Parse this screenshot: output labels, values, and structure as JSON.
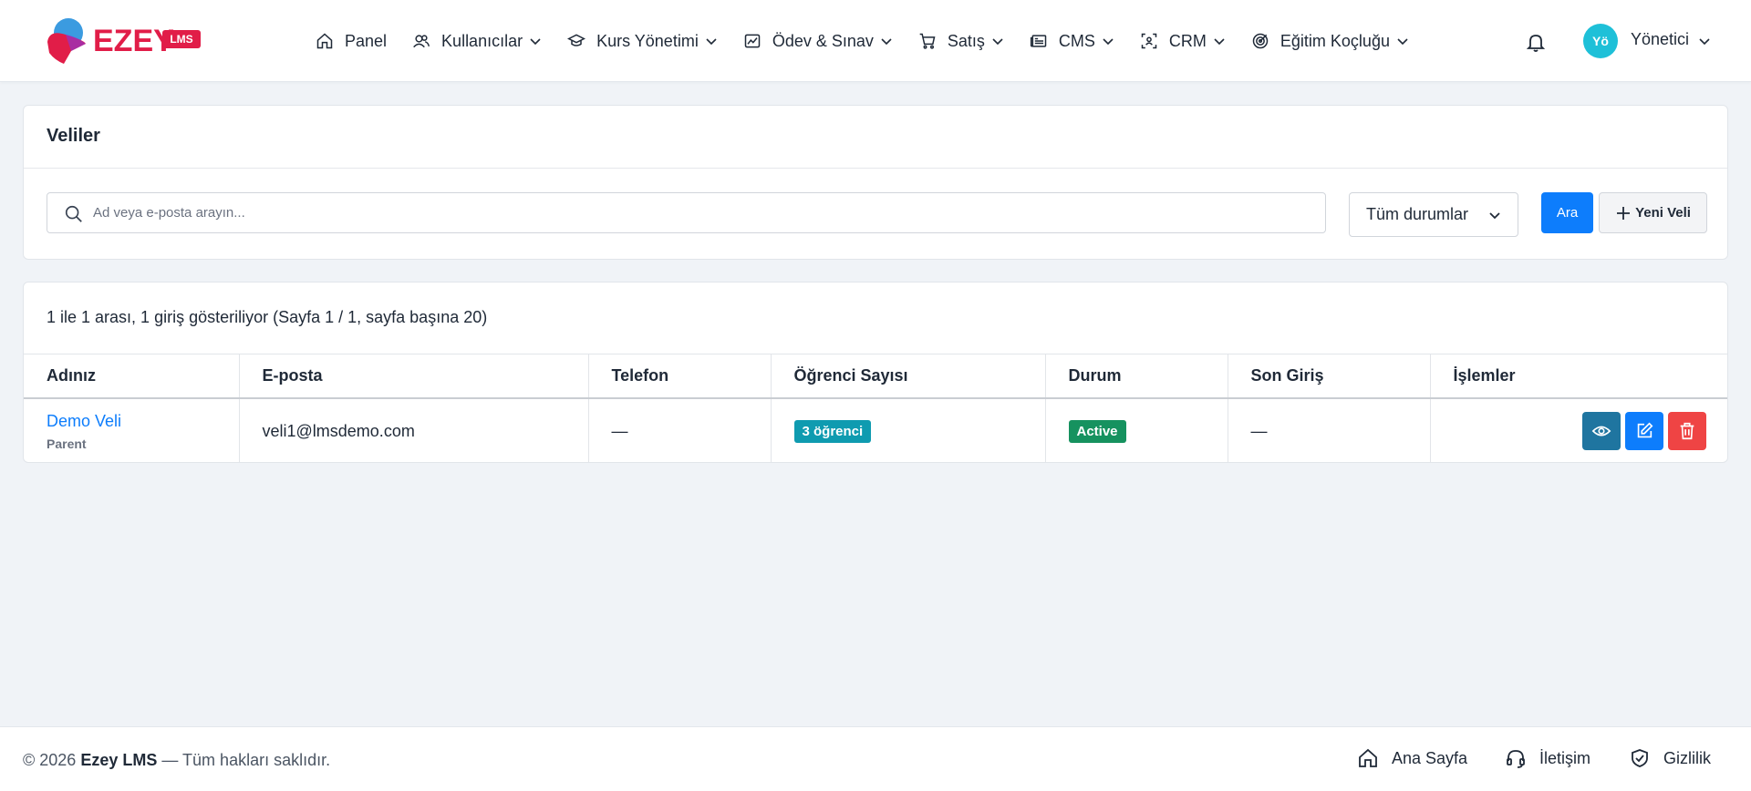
{
  "brand": {
    "name": "EZEY",
    "badge": "LMS"
  },
  "nav": {
    "items": [
      {
        "label": "Panel",
        "icon": "home-icon"
      },
      {
        "label": "Kullanıcılar",
        "icon": "users-icon"
      },
      {
        "label": "Kurs Yönetimi",
        "icon": "graduation-cap-icon"
      },
      {
        "label": "Ödev & Sınav",
        "icon": "chart-image-icon"
      },
      {
        "label": "Satış",
        "icon": "cart-icon"
      },
      {
        "label": "CMS",
        "icon": "newspaper-icon"
      },
      {
        "label": "CRM",
        "icon": "scan-person-icon"
      },
      {
        "label": "Eğitim Koçluğu",
        "icon": "target-icon"
      }
    ]
  },
  "user": {
    "initials": "Yö",
    "label": "Yönetici"
  },
  "search_card": {
    "title": "Veliler",
    "search_placeholder": "Ad veya e-posta arayın...",
    "status_selected": "Tüm durumlar",
    "search_button": "Ara",
    "new_button": "Yeni Veli"
  },
  "table_card": {
    "info": "1 ile 1 arası, 1 giriş gösteriliyor (Sayfa 1 / 1, sayfa başına 20)",
    "headers": [
      "Adınız",
      "E-posta",
      "Telefon",
      "Öğrenci Sayısı",
      "Durum",
      "Son Giriş",
      "İşlemler"
    ],
    "rows": [
      {
        "name": "Demo Veli",
        "role": "Parent",
        "email": "veli1@lmsdemo.com",
        "phone": "—",
        "students": "3 öğrenci",
        "status": "Active",
        "last_login": "—"
      }
    ]
  },
  "footer": {
    "copy_prefix": "© 2026",
    "copy_brand": "Ezey LMS",
    "copy_suffix": "— Tüm hakları saklıdır.",
    "links": [
      {
        "label": "Ana Sayfa",
        "icon": "home-icon"
      },
      {
        "label": "İletişim",
        "icon": "headset-icon"
      },
      {
        "label": "Gizlilik",
        "icon": "shield-check-icon"
      }
    ]
  },
  "colors": {
    "primary": "#0d7dfc",
    "brand": "#e11d48",
    "success": "#16925f",
    "info": "#0f9bb0",
    "danger": "#ef4444"
  }
}
